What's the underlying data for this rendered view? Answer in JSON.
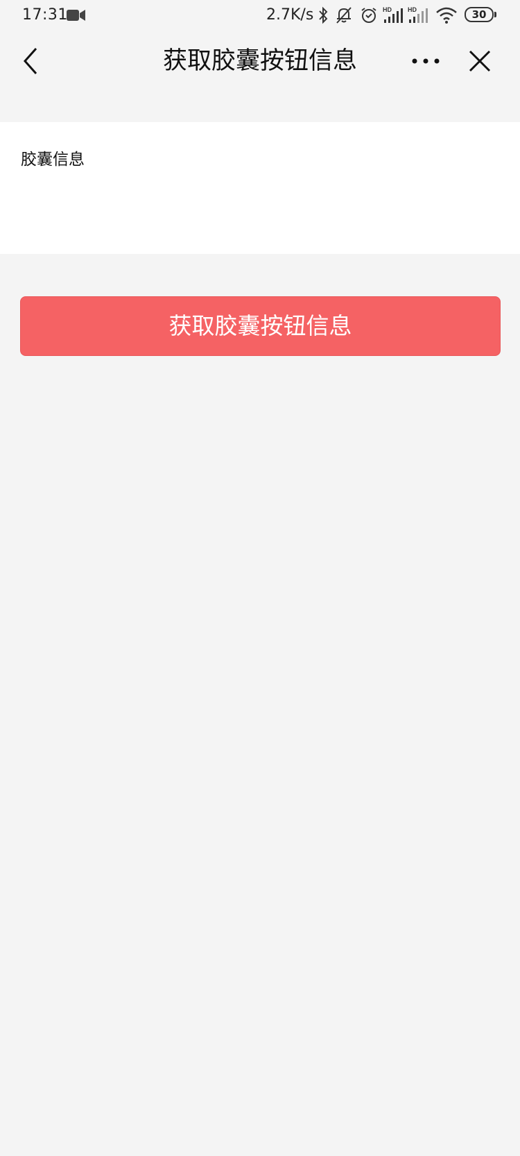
{
  "status_bar": {
    "time": "17:31",
    "net_speed": "2.7K/s",
    "battery_level": "30",
    "icons": [
      "video-camera-icon",
      "bluetooth-icon",
      "mute-bell-icon",
      "alarm-clock-icon",
      "signal-hd-icon",
      "signal-hd-icon",
      "wifi-icon",
      "battery-icon"
    ]
  },
  "nav": {
    "title": "获取胶囊按钮信息",
    "back_icon": "chevron-left-icon",
    "more_icon": "more-dots-icon",
    "close_icon": "close-icon"
  },
  "info_panel": {
    "label": "胶囊信息"
  },
  "main_button": {
    "label": "获取胶囊按钮信息",
    "color": "#f56264"
  },
  "colors": {
    "background": "#f4f4f4",
    "panel": "#ffffff",
    "accent": "#f56264"
  }
}
